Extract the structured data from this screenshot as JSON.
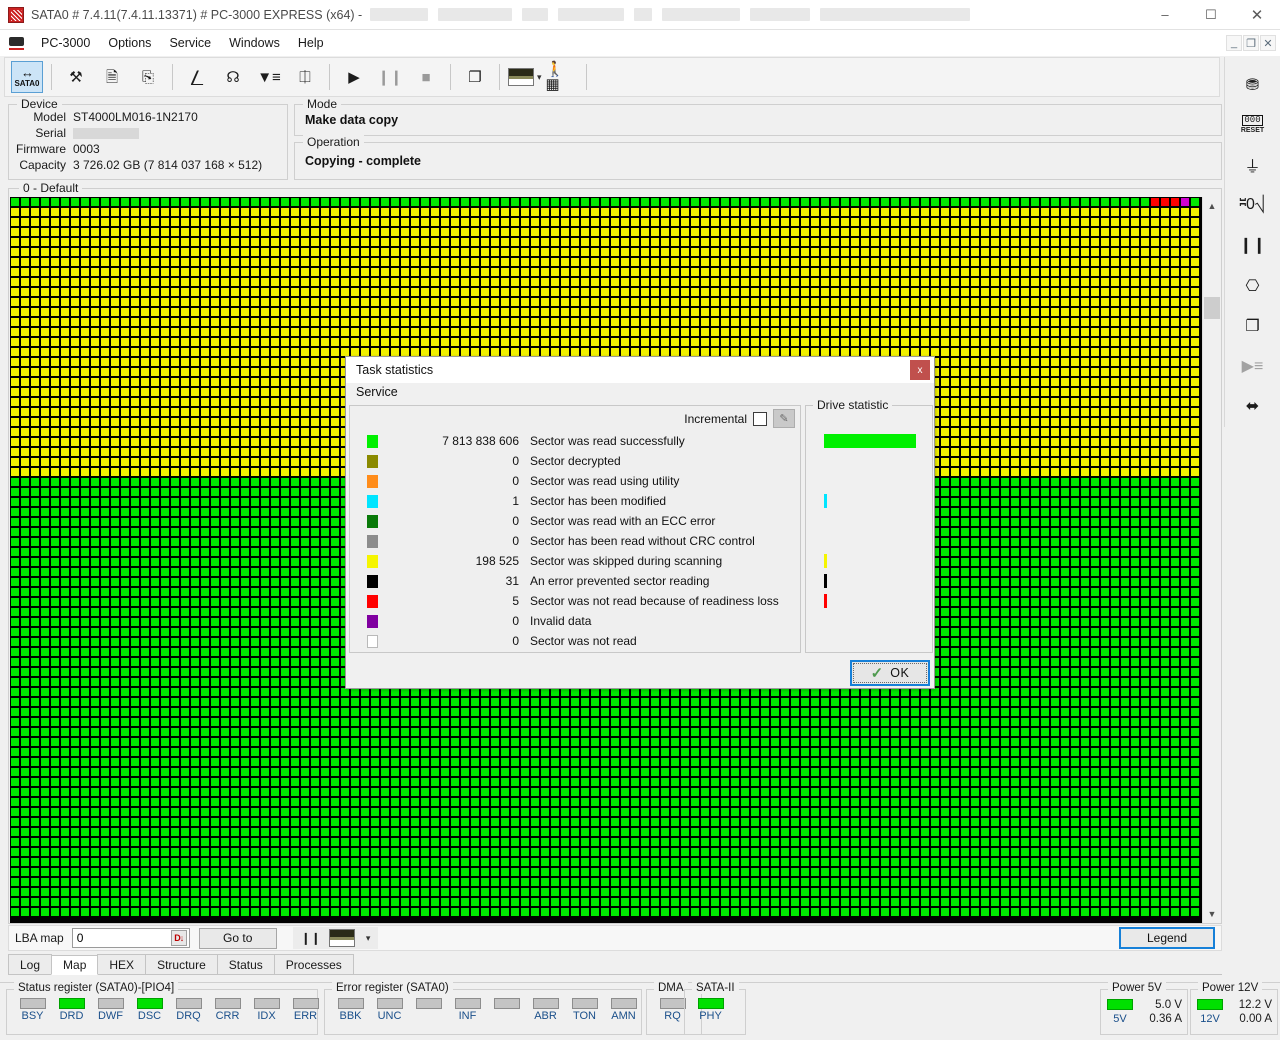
{
  "window": {
    "title": "SATA0 # 7.4.11(7.4.11.13371) # PC-3000 EXPRESS (x64) -",
    "minimize": "–",
    "maximize": "☐",
    "close": "✕",
    "mdi_minimize": "_",
    "mdi_restore": "❐",
    "mdi_close": "✕",
    "app_icon": "pc3000-app-icon"
  },
  "menubar": {
    "icon": "disk-drive-icon",
    "items": [
      "PC-3000",
      "Options",
      "Service",
      "Windows",
      "Help"
    ]
  },
  "toolbar": {
    "sata_label": "SATA0",
    "sata_glyph": "↔",
    "buttons": [
      {
        "name": "tools-icon",
        "glyph": "⚒"
      },
      {
        "name": "binary-report-icon",
        "glyph": "὜E"
      },
      {
        "name": "percent-report-icon",
        "glyph": "⎘"
      },
      {
        "name": "sector-list-icon",
        "glyph": "⌸"
      },
      {
        "name": "find-icon",
        "glyph": "☊"
      },
      {
        "name": "filter-icon",
        "glyph": "≡"
      },
      {
        "name": "disk-copy-icon",
        "glyph": "◔"
      },
      {
        "name": "play-icon",
        "glyph": "▶"
      },
      {
        "name": "pause-icon",
        "glyph": "⏸"
      },
      {
        "name": "stop-icon",
        "glyph": "■"
      },
      {
        "name": "copy-pages-icon",
        "glyph": "❐"
      },
      {
        "name": "preview-thumb-icon",
        "glyph": ""
      },
      {
        "name": "dropdown-caret-icon",
        "glyph": "▾"
      },
      {
        "name": "run-person-icon",
        "glyph": "Ὣ6"
      }
    ]
  },
  "device": {
    "group_label": "Device",
    "rows": [
      {
        "label": "Model",
        "value": "ST4000LM016-1N2170",
        "redacted": false
      },
      {
        "label": "Serial",
        "value": "",
        "redacted": true
      },
      {
        "label": "Firmware",
        "value": "0003",
        "redacted": false
      },
      {
        "label": "Capacity",
        "value": "3 726.02 GB (7 814 037 168 × 512)",
        "redacted": false
      }
    ]
  },
  "mode": {
    "group_label": "Mode",
    "value": "Make data copy"
  },
  "operation": {
    "group_label": "Operation",
    "value": "Copying - complete"
  },
  "map": {
    "group_label": "0 - Default",
    "scroll_up": "▲",
    "scroll_down": "▼",
    "colors": {
      "green": "#00e800",
      "yellow": "#f2f200",
      "red": "#ff0000",
      "magenta": "#d000d0",
      "border": "#000000"
    },
    "cols": 119,
    "rows": 72,
    "yellow_rows": 27,
    "top_row_marks": [
      {
        "col": 114,
        "color": "red"
      },
      {
        "col": 115,
        "color": "red"
      },
      {
        "col": 116,
        "color": "red"
      },
      {
        "col": 117,
        "color": "magenta"
      }
    ]
  },
  "lba_bar": {
    "label": "LBA map",
    "value": "0",
    "placeholder": "0",
    "dec_button": "D↓",
    "goto_label": "Go to",
    "pause_glyph": "❙❙",
    "caret": "▾",
    "legend_label": "Legend"
  },
  "tabs": {
    "items": [
      "Log",
      "Map",
      "HEX",
      "Structure",
      "Status",
      "Processes"
    ],
    "selected": "Map"
  },
  "status_register": {
    "group_label": "Status register (SATA0)-[PIO4]",
    "leds": [
      {
        "name": "BSY",
        "on": false
      },
      {
        "name": "DRD",
        "on": true
      },
      {
        "name": "DWF",
        "on": false
      },
      {
        "name": "DSC",
        "on": true
      },
      {
        "name": "DRQ",
        "on": false
      },
      {
        "name": "CRR",
        "on": false
      },
      {
        "name": "IDX",
        "on": false
      },
      {
        "name": "ERR",
        "on": false
      }
    ]
  },
  "error_register": {
    "group_label": "Error register (SATA0)",
    "leds": [
      {
        "name": "BBK",
        "on": false
      },
      {
        "name": "UNC",
        "on": false
      },
      {
        "name": "",
        "on": false
      },
      {
        "name": "INF",
        "on": false
      },
      {
        "name": "",
        "on": false
      },
      {
        "name": "ABR",
        "on": false
      },
      {
        "name": "TON",
        "on": false
      },
      {
        "name": "AMN",
        "on": false
      }
    ]
  },
  "dma": {
    "group_label": "DMA",
    "leds": [
      {
        "name": "RQ",
        "on": false
      }
    ]
  },
  "sata": {
    "group_label": "SATA-II",
    "leds": [
      {
        "name": "PHY",
        "on": true
      }
    ]
  },
  "power_5v": {
    "group_label": "Power 5V",
    "led_on": true,
    "rail": "5V",
    "voltage": "5.0 V",
    "current": "0.36 A"
  },
  "power_12v": {
    "group_label": "Power 12V",
    "led_on": true,
    "rail": "12V",
    "voltage": "12.2 V",
    "current": "0.00 A"
  },
  "sidebar": {
    "buttons": [
      {
        "name": "disk-copy-icon",
        "glyph": "⛃"
      },
      {
        "name": "reset-counter-icon",
        "glyph": "000"
      },
      {
        "name": "power-switch-icon",
        "glyph": "⏚"
      },
      {
        "name": "id-scale-icon",
        "glyph": "Ⓘ"
      },
      {
        "name": "pause-icon",
        "glyph": "❙❙"
      },
      {
        "name": "clear-counters-icon",
        "glyph": "⌨"
      },
      {
        "name": "close-copies-icon",
        "glyph": "❐"
      },
      {
        "name": "run-filter-icon",
        "glyph": "▶"
      },
      {
        "name": "connector-icon",
        "glyph": "⬌"
      }
    ]
  },
  "dialog": {
    "title": "Task statistics",
    "close_glyph": "x",
    "subtitle": "Service",
    "incremental_label": "Incremental",
    "incremental_checked": false,
    "pen_icon": "edit-pen-icon",
    "drive_statistic_label": "Drive statistic",
    "ok_label": "OK",
    "ok_check": "✓",
    "stats": [
      {
        "color": "#00f000",
        "count": "7 813 838 606",
        "label": "Sector was read successfully",
        "bar_pct": 100
      },
      {
        "color": "#8a8a00",
        "count": "0",
        "label": "Sector decrypted",
        "bar_pct": 0
      },
      {
        "color": "#ff8c1a",
        "count": "0",
        "label": "Sector was read using utility",
        "bar_pct": 0
      },
      {
        "color": "#00e5ff",
        "count": "1",
        "label": "Sector has been modified",
        "bar_pct": 2
      },
      {
        "color": "#0a7a0a",
        "count": "0",
        "label": "Sector was read with an ECC error",
        "bar_pct": 0
      },
      {
        "color": "#8c8c8c",
        "count": "0",
        "label": "Sector has been read without CRC control",
        "bar_pct": 0
      },
      {
        "color": "#f5f500",
        "count": "198 525",
        "label": "Sector was skipped during scanning",
        "bar_pct": 2
      },
      {
        "color": "#000000",
        "count": "31",
        "label": "An error prevented sector reading",
        "bar_pct": 2
      },
      {
        "color": "#ff0000",
        "count": "5",
        "label": "Sector was not read because of readiness loss",
        "bar_pct": 2
      },
      {
        "color": "#8000a0",
        "count": "0",
        "label": "Invalid data",
        "bar_pct": 0
      },
      {
        "color": "#ffffff",
        "count": "0",
        "label": "Sector was not read",
        "bar_pct": 0
      }
    ]
  }
}
